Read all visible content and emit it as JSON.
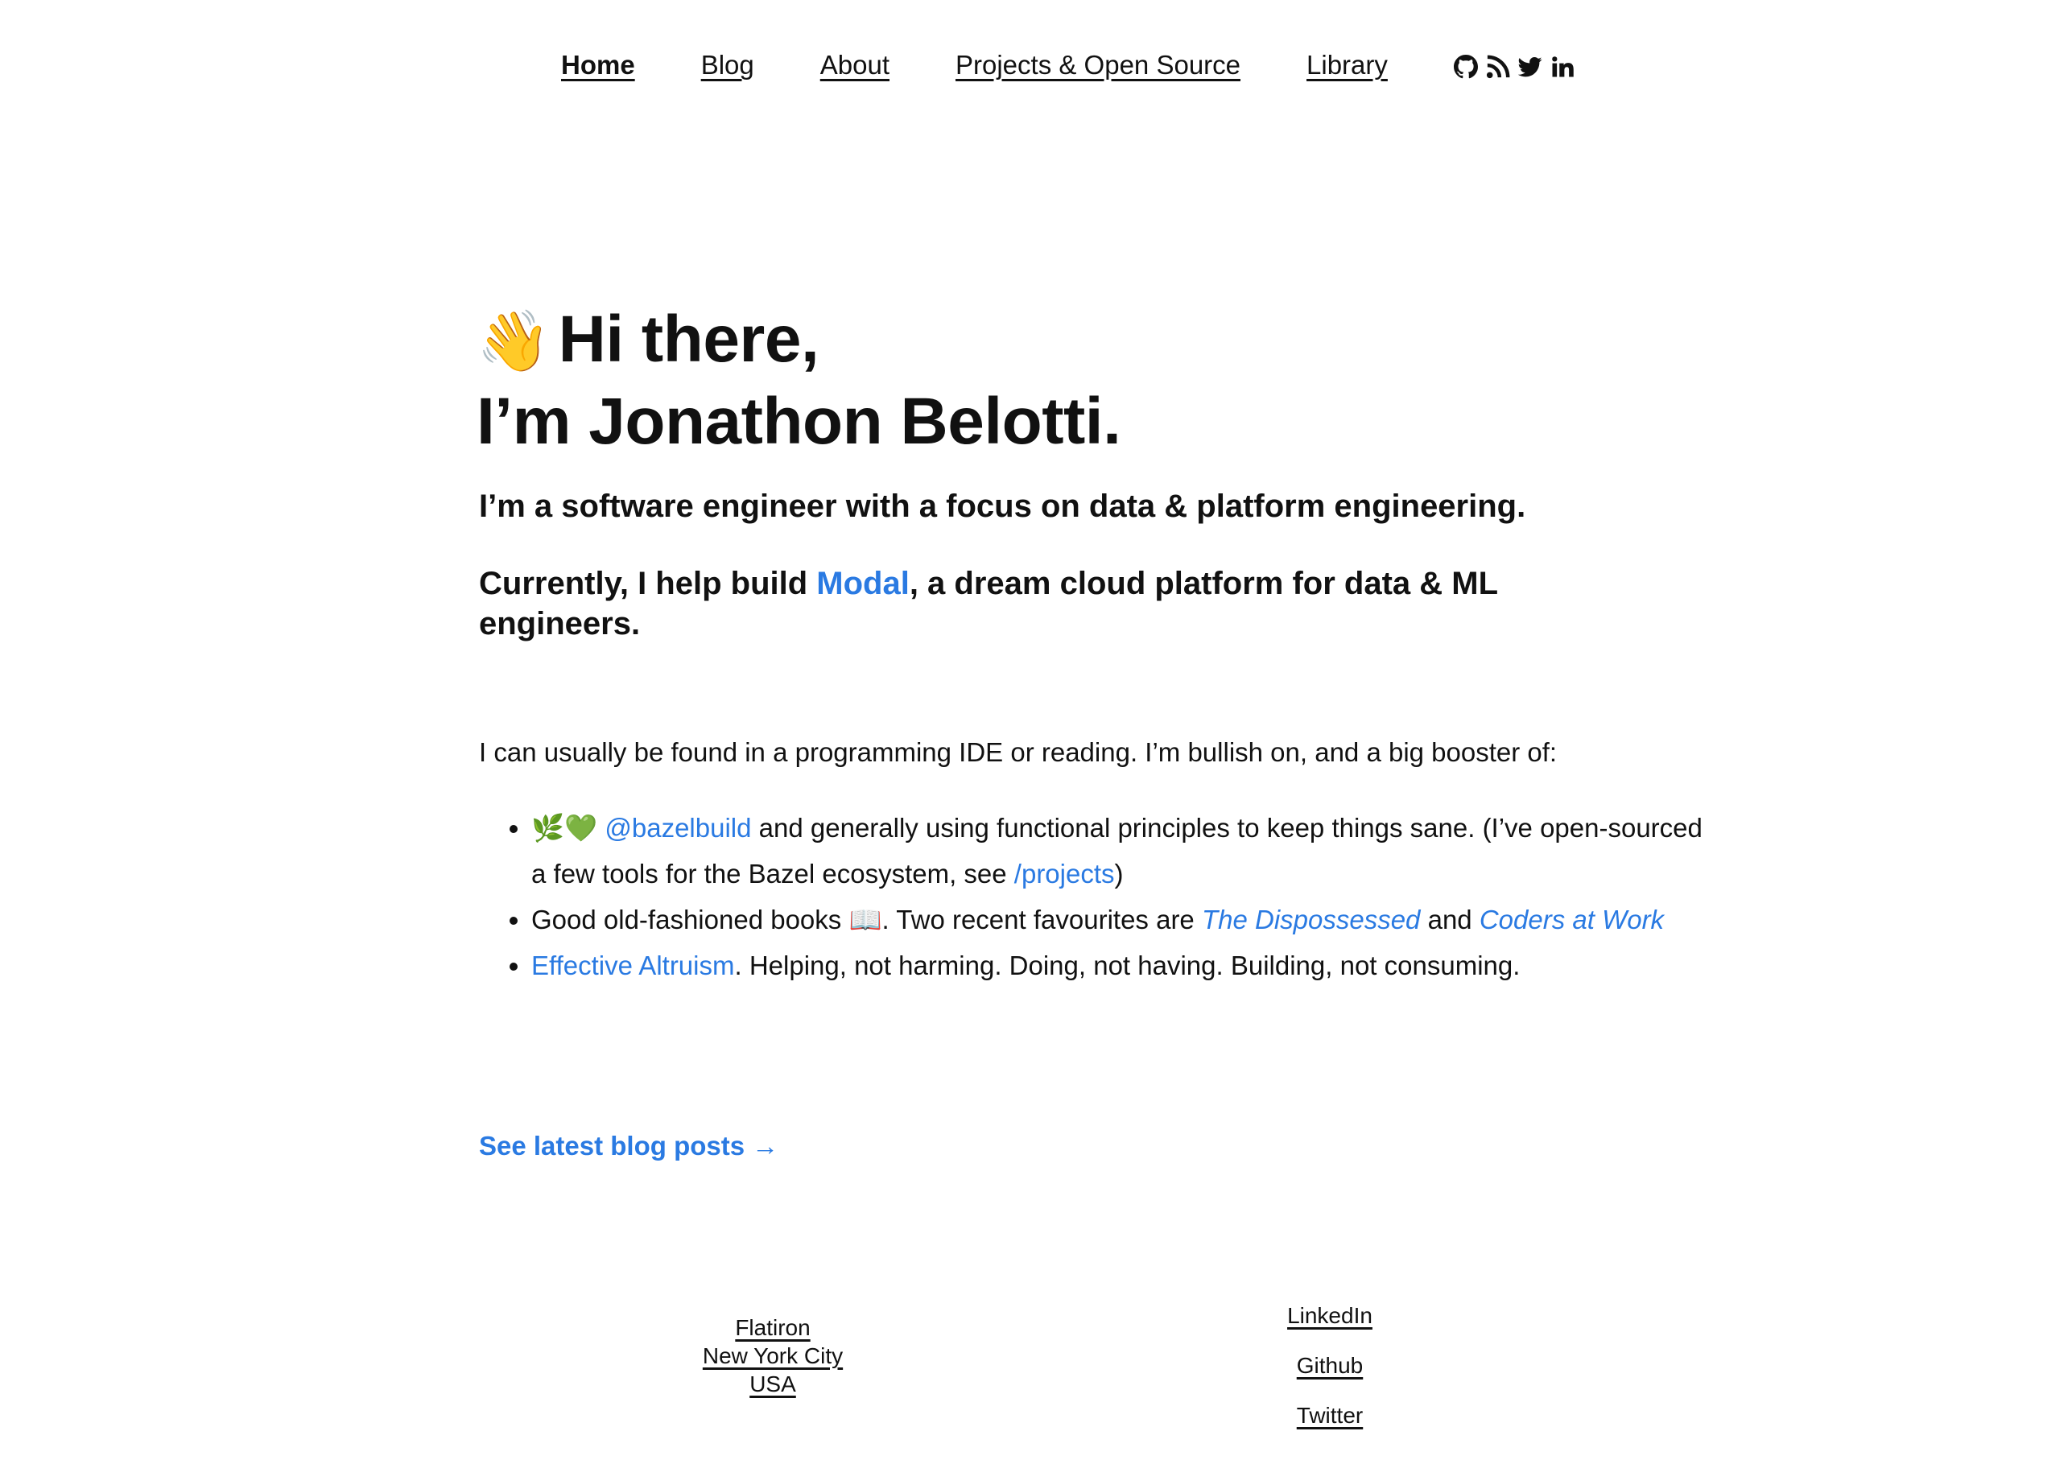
{
  "nav": {
    "items": [
      {
        "label": "Home",
        "active": true
      },
      {
        "label": "Blog",
        "active": false
      },
      {
        "label": "About",
        "active": false
      },
      {
        "label": "Projects & Open Source",
        "active": false
      },
      {
        "label": "Library",
        "active": false
      }
    ],
    "icons": [
      "github-icon",
      "rss-icon",
      "twitter-icon",
      "linkedin-icon"
    ]
  },
  "hero": {
    "wave_emoji": "👋",
    "line1": "Hi there,",
    "line2": "I’m Jonathon Belotti."
  },
  "intro": {
    "line1": "I’m a software engineer with a focus on data & platform engineering.",
    "line2_prefix": "Currently, I help build ",
    "line2_link": "Modal",
    "line2_suffix": ", a dream cloud platform for data & ML engineers."
  },
  "about": {
    "paragraph": "I can usually be found in a programming IDE or reading. I’m bullish on, and a big booster of:",
    "list": [
      {
        "emoji": "🌿💚",
        "link": "@bazelbuild",
        "text": " and generally using functional principles to keep things sane. (I’ve open-sourced a few tools for the Bazel ecosystem, see ",
        "link2": "/projects",
        "text2": ")"
      },
      {
        "text": "Good old-fashioned books ",
        "emoji": "📖",
        "text2": ". Two recent favourites are ",
        "book1": "The Dispossessed",
        "and": " and ",
        "book2": "Coders at Work"
      },
      {
        "link": "Effective Altruism",
        "text": ". Helping, not harming. Doing, not having. Building, not consuming."
      }
    ]
  },
  "blog_link": "See latest blog posts →",
  "footer": {
    "location": [
      "Flatiron",
      "New York City",
      "USA"
    ],
    "social": [
      "LinkedIn",
      "Github",
      "Twitter"
    ]
  },
  "colors": {
    "accent": "#2a7ae2",
    "text": "#111111",
    "background": "#ffffff"
  }
}
